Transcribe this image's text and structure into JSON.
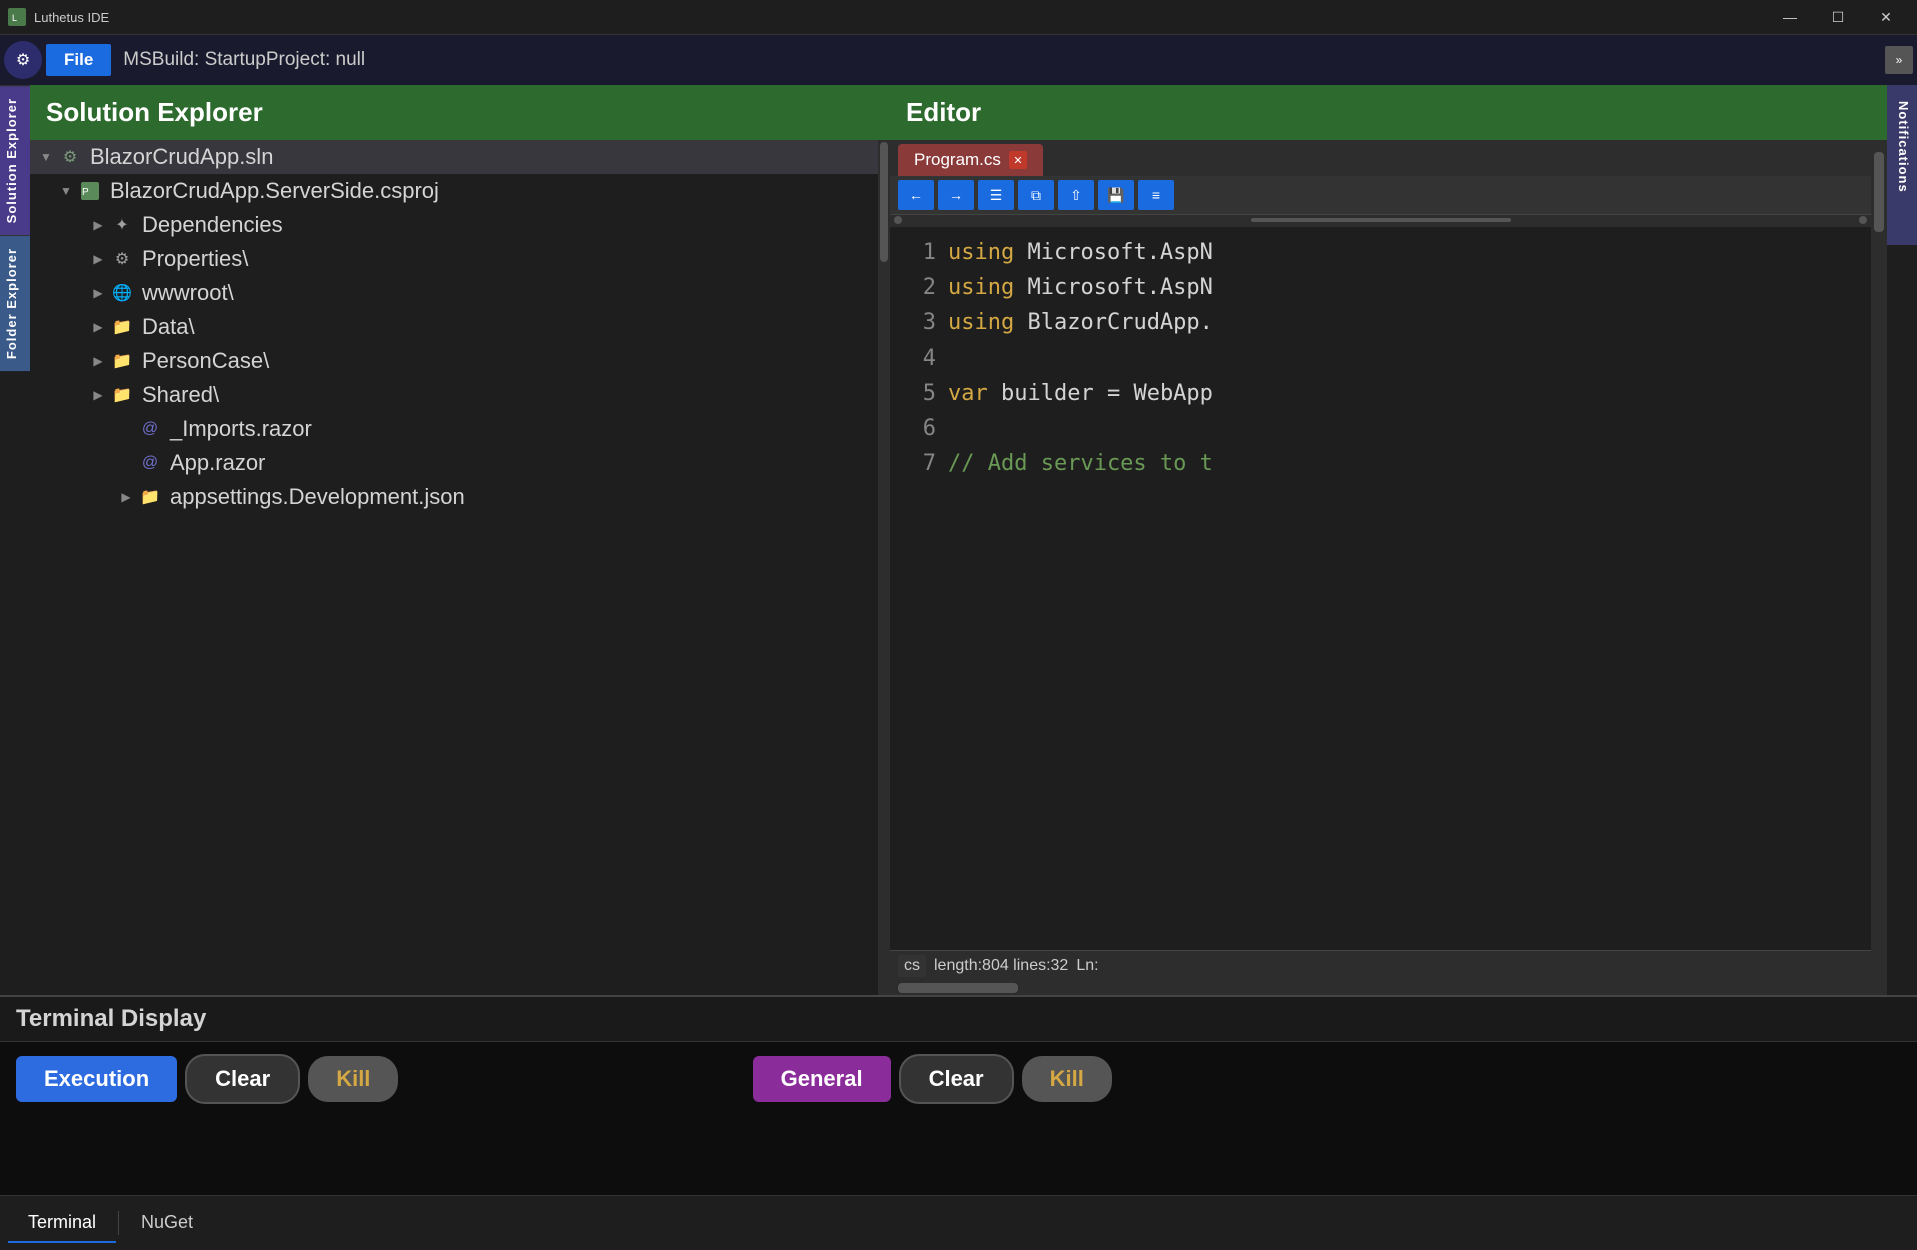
{
  "titleBar": {
    "appName": "Luthetus IDE",
    "controls": {
      "minimize": "—",
      "maximize": "☐",
      "close": "✕"
    }
  },
  "menuBar": {
    "gearIcon": "⚙",
    "fileLabel": "File",
    "msBuildText": "MSBuild: StartupProject:  null",
    "chevronIcon": "»"
  },
  "solutionExplorer": {
    "title": "Solution Explorer",
    "tree": {
      "solutionFile": "BlazorCrudApp.sln",
      "projectFile": "BlazorCrudApp.ServerSide.csproj",
      "items": [
        {
          "label": "Dependencies",
          "icon": "deps",
          "indent": 1
        },
        {
          "label": "Properties\\",
          "icon": "props",
          "indent": 1
        },
        {
          "label": "wwwroot\\",
          "icon": "globe",
          "indent": 1
        },
        {
          "label": "Data\\",
          "icon": "folder",
          "indent": 1
        },
        {
          "label": "PersonCase\\",
          "icon": "folder",
          "indent": 1
        },
        {
          "label": "Shared\\",
          "icon": "folder",
          "indent": 1
        },
        {
          "label": "_Imports.razor",
          "icon": "razor",
          "indent": 2
        },
        {
          "label": "App.razor",
          "icon": "razor",
          "indent": 2
        },
        {
          "label": "appsettings.Development.json",
          "icon": "folder",
          "indent": 2
        }
      ]
    }
  },
  "editor": {
    "title": "Editor",
    "tab": {
      "filename": "Program.cs",
      "closeIcon": "✕"
    },
    "toolbar": {
      "backIcon": "←",
      "forwardIcon": "→",
      "btn3": "☰",
      "btn4": "⧉",
      "btn5": "⇧",
      "btn6": "💾",
      "btn7": "≡"
    },
    "codeLines": [
      {
        "num": "1",
        "content": "using Microsoft.AspN"
      },
      {
        "num": "2",
        "content": "using Microsoft.AspN"
      },
      {
        "num": "3",
        "content": "using BlazorCrudApp."
      },
      {
        "num": "4",
        "content": ""
      },
      {
        "num": "5",
        "content": "var builder = WebApp"
      },
      {
        "num": "6",
        "content": ""
      },
      {
        "num": "7",
        "content": "// Add services to t"
      }
    ],
    "status": {
      "lang": "cs",
      "info": "length:804  lines:32",
      "cursor": "Ln:"
    }
  },
  "notifications": {
    "tabLabel": "Notifications"
  },
  "terminal": {
    "title": "Terminal Display",
    "executionLabel": "Execution",
    "clearLabel1": "Clear",
    "killLabel1": "Kill",
    "generalLabel": "General",
    "clearLabel2": "Clear",
    "killLabel2": "Kill"
  },
  "bottomTabs": {
    "terminal": "Terminal",
    "nuget": "NuGet"
  },
  "sidebar": {
    "solutionTab": "Solution Explorer",
    "folderTab": "Folder Explorer"
  }
}
